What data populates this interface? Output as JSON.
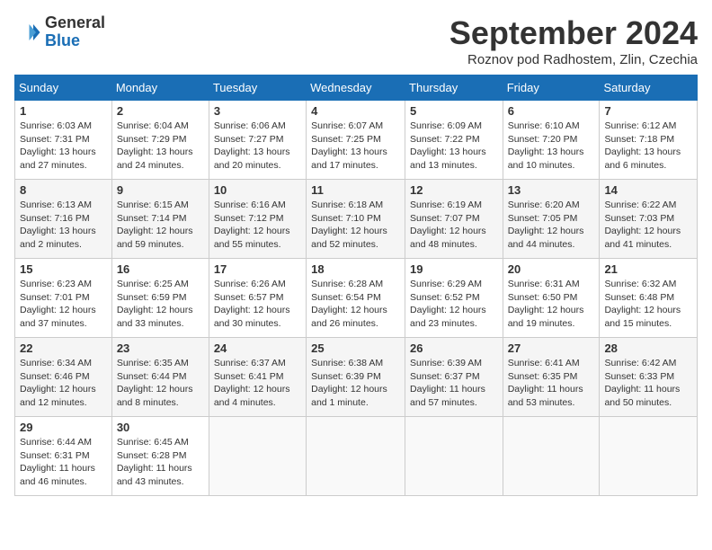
{
  "logo": {
    "general": "General",
    "blue": "Blue"
  },
  "title": {
    "month_year": "September 2024",
    "location": "Roznov pod Radhostem, Zlin, Czechia"
  },
  "calendar": {
    "headers": [
      "Sunday",
      "Monday",
      "Tuesday",
      "Wednesday",
      "Thursday",
      "Friday",
      "Saturday"
    ],
    "weeks": [
      [
        {
          "day": "",
          "detail": ""
        },
        {
          "day": "2",
          "detail": "Sunrise: 6:04 AM\nSunset: 7:29 PM\nDaylight: 13 hours and 24 minutes."
        },
        {
          "day": "3",
          "detail": "Sunrise: 6:06 AM\nSunset: 7:27 PM\nDaylight: 13 hours and 20 minutes."
        },
        {
          "day": "4",
          "detail": "Sunrise: 6:07 AM\nSunset: 7:25 PM\nDaylight: 13 hours and 17 minutes."
        },
        {
          "day": "5",
          "detail": "Sunrise: 6:09 AM\nSunset: 7:22 PM\nDaylight: 13 hours and 13 minutes."
        },
        {
          "day": "6",
          "detail": "Sunrise: 6:10 AM\nSunset: 7:20 PM\nDaylight: 13 hours and 10 minutes."
        },
        {
          "day": "7",
          "detail": "Sunrise: 6:12 AM\nSunset: 7:18 PM\nDaylight: 13 hours and 6 minutes."
        }
      ],
      [
        {
          "day": "1",
          "detail": "Sunrise: 6:03 AM\nSunset: 7:31 PM\nDaylight: 13 hours and 27 minutes."
        },
        {
          "day": "9",
          "detail": "Sunrise: 6:15 AM\nSunset: 7:14 PM\nDaylight: 12 hours and 59 minutes."
        },
        {
          "day": "10",
          "detail": "Sunrise: 6:16 AM\nSunset: 7:12 PM\nDaylight: 12 hours and 55 minutes."
        },
        {
          "day": "11",
          "detail": "Sunrise: 6:18 AM\nSunset: 7:10 PM\nDaylight: 12 hours and 52 minutes."
        },
        {
          "day": "12",
          "detail": "Sunrise: 6:19 AM\nSunset: 7:07 PM\nDaylight: 12 hours and 48 minutes."
        },
        {
          "day": "13",
          "detail": "Sunrise: 6:20 AM\nSunset: 7:05 PM\nDaylight: 12 hours and 44 minutes."
        },
        {
          "day": "14",
          "detail": "Sunrise: 6:22 AM\nSunset: 7:03 PM\nDaylight: 12 hours and 41 minutes."
        }
      ],
      [
        {
          "day": "8",
          "detail": "Sunrise: 6:13 AM\nSunset: 7:16 PM\nDaylight: 13 hours and 2 minutes."
        },
        {
          "day": "16",
          "detail": "Sunrise: 6:25 AM\nSunset: 6:59 PM\nDaylight: 12 hours and 33 minutes."
        },
        {
          "day": "17",
          "detail": "Sunrise: 6:26 AM\nSunset: 6:57 PM\nDaylight: 12 hours and 30 minutes."
        },
        {
          "day": "18",
          "detail": "Sunrise: 6:28 AM\nSunset: 6:54 PM\nDaylight: 12 hours and 26 minutes."
        },
        {
          "day": "19",
          "detail": "Sunrise: 6:29 AM\nSunset: 6:52 PM\nDaylight: 12 hours and 23 minutes."
        },
        {
          "day": "20",
          "detail": "Sunrise: 6:31 AM\nSunset: 6:50 PM\nDaylight: 12 hours and 19 minutes."
        },
        {
          "day": "21",
          "detail": "Sunrise: 6:32 AM\nSunset: 6:48 PM\nDaylight: 12 hours and 15 minutes."
        }
      ],
      [
        {
          "day": "15",
          "detail": "Sunrise: 6:23 AM\nSunset: 7:01 PM\nDaylight: 12 hours and 37 minutes."
        },
        {
          "day": "23",
          "detail": "Sunrise: 6:35 AM\nSunset: 6:44 PM\nDaylight: 12 hours and 8 minutes."
        },
        {
          "day": "24",
          "detail": "Sunrise: 6:37 AM\nSunset: 6:41 PM\nDaylight: 12 hours and 4 minutes."
        },
        {
          "day": "25",
          "detail": "Sunrise: 6:38 AM\nSunset: 6:39 PM\nDaylight: 12 hours and 1 minute."
        },
        {
          "day": "26",
          "detail": "Sunrise: 6:39 AM\nSunset: 6:37 PM\nDaylight: 11 hours and 57 minutes."
        },
        {
          "day": "27",
          "detail": "Sunrise: 6:41 AM\nSunset: 6:35 PM\nDaylight: 11 hours and 53 minutes."
        },
        {
          "day": "28",
          "detail": "Sunrise: 6:42 AM\nSunset: 6:33 PM\nDaylight: 11 hours and 50 minutes."
        }
      ],
      [
        {
          "day": "22",
          "detail": "Sunrise: 6:34 AM\nSunset: 6:46 PM\nDaylight: 12 hours and 12 minutes."
        },
        {
          "day": "30",
          "detail": "Sunrise: 6:45 AM\nSunset: 6:28 PM\nDaylight: 11 hours and 43 minutes."
        },
        {
          "day": "",
          "detail": ""
        },
        {
          "day": "",
          "detail": ""
        },
        {
          "day": "",
          "detail": ""
        },
        {
          "day": "",
          "detail": ""
        },
        {
          "day": "",
          "detail": ""
        }
      ],
      [
        {
          "day": "29",
          "detail": "Sunrise: 6:44 AM\nSunset: 6:31 PM\nDaylight: 11 hours and 46 minutes."
        },
        {
          "day": "",
          "detail": ""
        },
        {
          "day": "",
          "detail": ""
        },
        {
          "day": "",
          "detail": ""
        },
        {
          "day": "",
          "detail": ""
        },
        {
          "day": "",
          "detail": ""
        },
        {
          "day": "",
          "detail": ""
        }
      ]
    ]
  }
}
